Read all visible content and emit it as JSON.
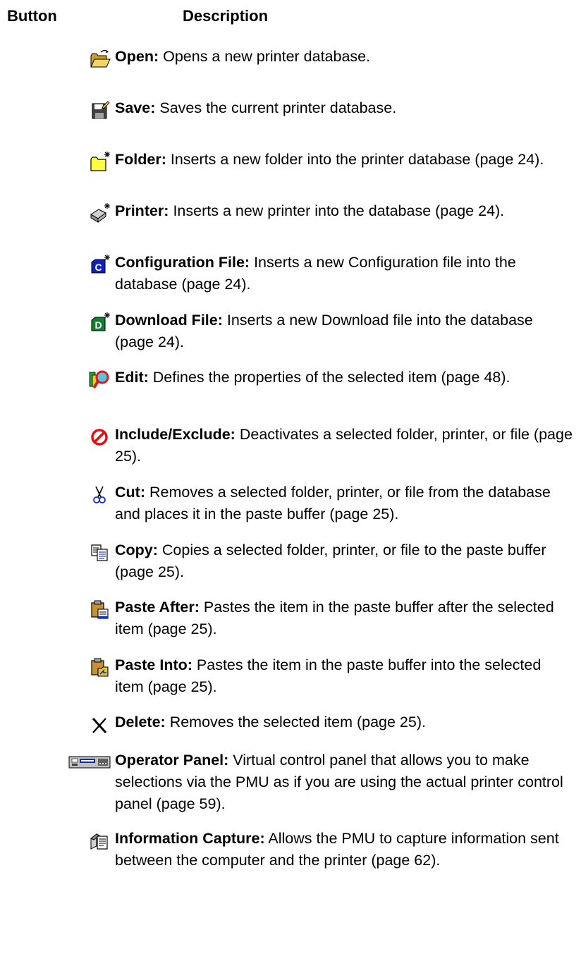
{
  "header": {
    "button_label": "Button",
    "description_label": "Description"
  },
  "items": [
    {
      "icon": "open-folder-icon",
      "name": "Open:",
      "text": "Opens a new printer database."
    },
    {
      "icon": "save-disk-icon",
      "name": "Save:",
      "text": "Saves the current printer database."
    },
    {
      "icon": "new-folder-icon",
      "name": "Folder:",
      "text": "Inserts a new folder into the printer database (page 24)."
    },
    {
      "icon": "new-printer-icon",
      "name": "Printer:",
      "text": "Inserts a new printer into the database (page 24)."
    },
    {
      "icon": "new-config-file-icon",
      "name": "Configuration File:",
      "text": "Inserts a new Configuration file into the database (page 24)."
    },
    {
      "icon": "new-download-file-icon",
      "name": "Download File:",
      "text": "Inserts a new Download file into the database (page 24)."
    },
    {
      "icon": "edit-magnifier-icon",
      "name": "Edit:",
      "text": "Defines the properties of the selected item (page 48)."
    },
    {
      "icon": "include-exclude-icon",
      "name": "Include/Exclude:",
      "text": "Deactivates a selected folder, printer, or file (page 25)."
    },
    {
      "icon": "cut-scissors-icon",
      "name": "Cut:",
      "text": "Removes a selected folder, printer, or file from the database and places it in the paste buffer (page 25)."
    },
    {
      "icon": "copy-icon",
      "name": "Copy:",
      "text": "Copies a selected folder, printer, or file to the paste buffer (page 25)."
    },
    {
      "icon": "paste-after-icon",
      "name": "Paste After:",
      "text": "Pastes the item in the paste buffer after the selected item (page 25)."
    },
    {
      "icon": "paste-into-icon",
      "name": "Paste Into:",
      "text": "Pastes the item in the paste buffer into the selected item (page 25)."
    },
    {
      "icon": "delete-x-icon",
      "name": "Delete:",
      "text": "Removes the selected item (page 25)."
    },
    {
      "icon": "operator-panel-icon",
      "name": "Operator Panel:",
      "text": "Virtual control panel that allows you to make selections via the PMU as if you are using the actual printer control panel (page 59)."
    },
    {
      "icon": "information-capture-icon",
      "name": "Information Capture:",
      "text": "Allows the PMU to capture information sent between the computer and the printer (page 62)."
    }
  ]
}
